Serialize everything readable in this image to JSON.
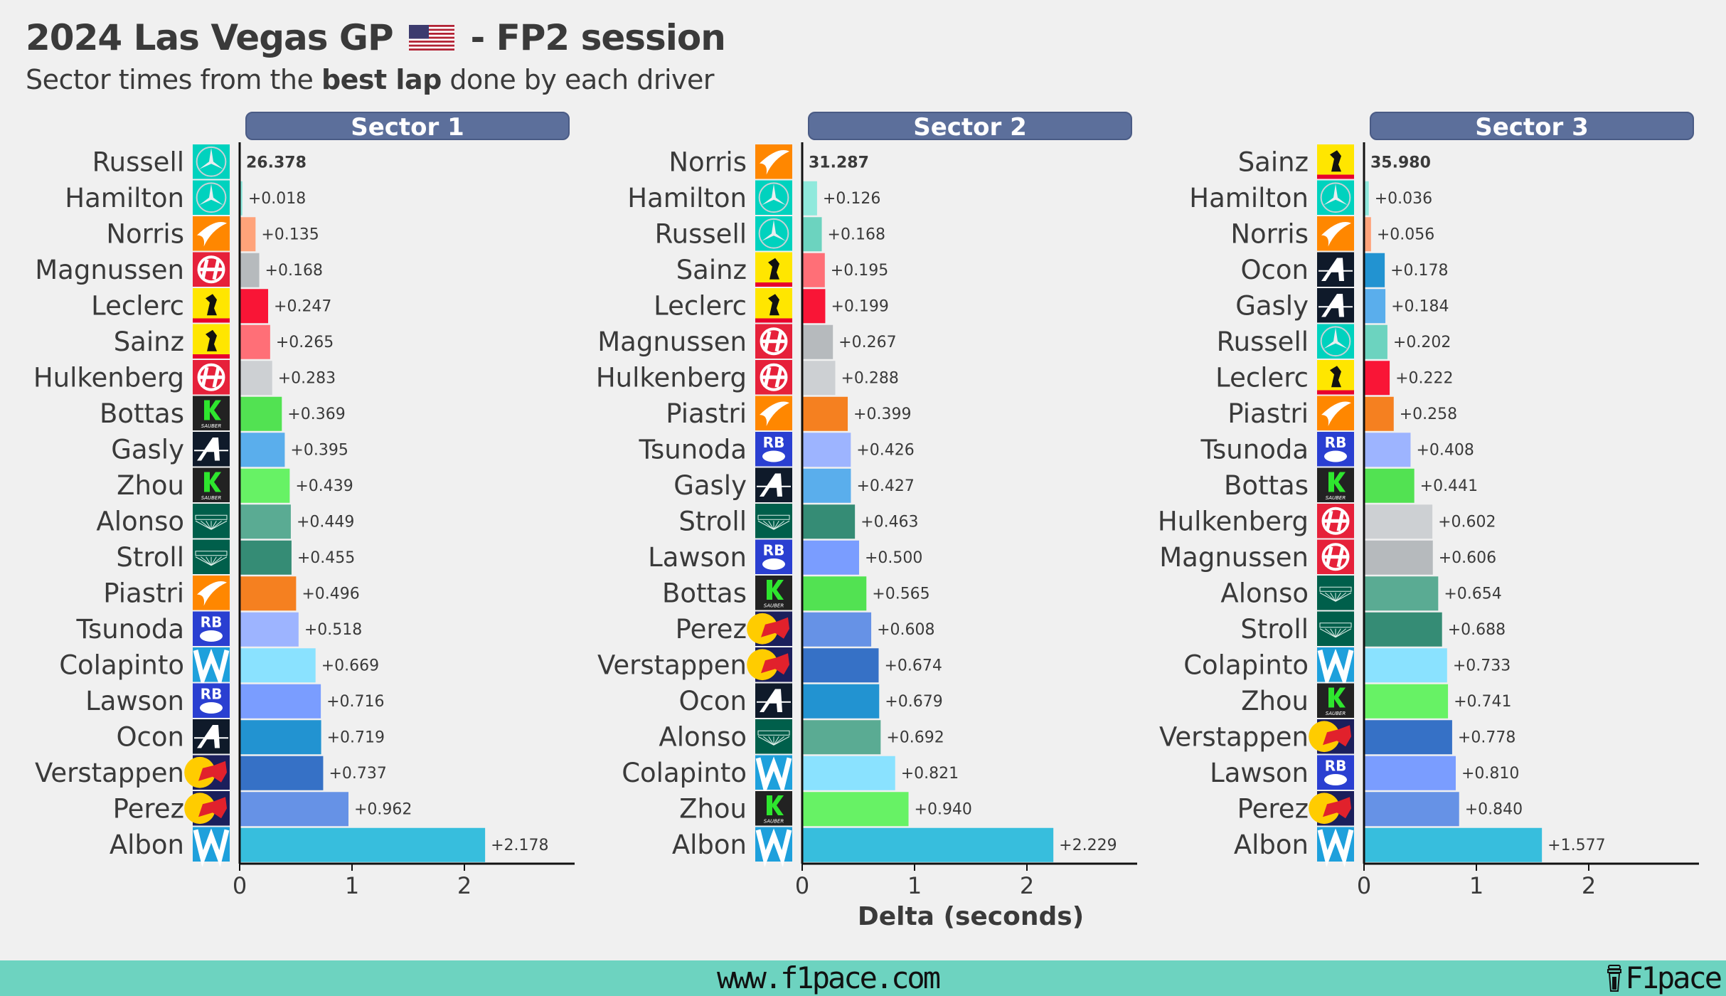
{
  "header": {
    "title_pre": "2024 Las Vegas GP",
    "title_post": "- FP2 session",
    "flag_icon": "us-flag-icon",
    "subtitle_pre": "Sector times from the ",
    "subtitle_bold": "best lap",
    "subtitle_post": " done by each driver"
  },
  "footer": {
    "url": "www.f1pace.com",
    "brand": "F1pace",
    "brand_icon": "coffee-cup-icon",
    "color": "#6dd3c0"
  },
  "teams": {
    "mercedes": {
      "icon": "mercedes-logo-icon",
      "bg": "#00d2be"
    },
    "mclaren": {
      "icon": "mclaren-logo-icon",
      "bg": "#ff8700"
    },
    "haas": {
      "icon": "haas-logo-icon",
      "bg": "#e6213a"
    },
    "ferrari": {
      "icon": "ferrari-logo-icon",
      "bg": "#ffe600"
    },
    "sauber": {
      "icon": "sauber-logo-icon",
      "bg": "#222222"
    },
    "alpine": {
      "icon": "alpine-logo-icon",
      "bg": "#0f1a2a"
    },
    "aston": {
      "icon": "aston-martin-logo-icon",
      "bg": "#005f4b"
    },
    "rb": {
      "icon": "rb-logo-icon",
      "bg": "#2a3fd1"
    },
    "williams": {
      "icon": "williams-logo-icon",
      "bg": "#1ea0dc"
    },
    "redbull": {
      "icon": "red-bull-logo-icon",
      "bg": "#1b1f5c"
    }
  },
  "chart_data": [
    {
      "type": "bar",
      "orientation": "horizontal",
      "title": "Sector 1",
      "xlabel": "",
      "xlim": [
        0,
        2.9
      ],
      "xticks": [
        0,
        1,
        2
      ],
      "best_time_label": "26.378",
      "drivers": [
        "Russell",
        "Hamilton",
        "Norris",
        "Magnussen",
        "Leclerc",
        "Sainz",
        "Hulkenberg",
        "Bottas",
        "Gasly",
        "Zhou",
        "Alonso",
        "Stroll",
        "Piastri",
        "Tsunoda",
        "Colapinto",
        "Lawson",
        "Ocon",
        "Verstappen",
        "Perez",
        "Albon"
      ],
      "teams": [
        "mercedes",
        "mercedes",
        "mclaren",
        "haas",
        "ferrari",
        "ferrari",
        "haas",
        "sauber",
        "alpine",
        "sauber",
        "aston",
        "aston",
        "mclaren",
        "rb",
        "williams",
        "rb",
        "alpine",
        "redbull",
        "redbull",
        "williams"
      ],
      "values": [
        0,
        0.018,
        0.135,
        0.168,
        0.247,
        0.265,
        0.283,
        0.369,
        0.395,
        0.439,
        0.449,
        0.455,
        0.496,
        0.518,
        0.669,
        0.716,
        0.719,
        0.737,
        0.962,
        2.178
      ],
      "labels": [
        "26.378",
        "+0.018",
        "+0.135",
        "+0.168",
        "+0.247",
        "+0.265",
        "+0.283",
        "+0.369",
        "+0.395",
        "+0.439",
        "+0.449",
        "+0.455",
        "+0.496",
        "+0.518",
        "+0.669",
        "+0.716",
        "+0.719",
        "+0.737",
        "+0.962",
        "+2.178"
      ],
      "colors": [
        "#6cd3bf",
        "#8fe9dc",
        "#ffa37a",
        "#b6babd",
        "#f91536",
        "#ff6f77",
        "#cdd0d3",
        "#52e252",
        "#5aaeec",
        "#67f265",
        "#5aab93",
        "#358c75",
        "#f58020",
        "#9db4ff",
        "#8ae2ff",
        "#7a9dff",
        "#2293d1",
        "#3671c6",
        "#6692e6",
        "#37bedd"
      ]
    },
    {
      "type": "bar",
      "orientation": "horizontal",
      "title": "Sector 2",
      "xlabel": "Delta (seconds)",
      "xlim": [
        0,
        2.9
      ],
      "xticks": [
        0,
        1,
        2
      ],
      "best_time_label": "31.287",
      "drivers": [
        "Norris",
        "Hamilton",
        "Russell",
        "Sainz",
        "Leclerc",
        "Magnussen",
        "Hulkenberg",
        "Piastri",
        "Tsunoda",
        "Gasly",
        "Stroll",
        "Lawson",
        "Bottas",
        "Perez",
        "Verstappen",
        "Ocon",
        "Alonso",
        "Colapinto",
        "Zhou",
        "Albon"
      ],
      "teams": [
        "mclaren",
        "mercedes",
        "mercedes",
        "ferrari",
        "ferrari",
        "haas",
        "haas",
        "mclaren",
        "rb",
        "alpine",
        "aston",
        "rb",
        "sauber",
        "redbull",
        "redbull",
        "alpine",
        "aston",
        "williams",
        "sauber",
        "williams"
      ],
      "values": [
        0,
        0.126,
        0.168,
        0.195,
        0.199,
        0.267,
        0.288,
        0.399,
        0.426,
        0.427,
        0.463,
        0.5,
        0.565,
        0.608,
        0.674,
        0.679,
        0.692,
        0.821,
        0.94,
        2.229
      ],
      "labels": [
        "31.287",
        "+0.126",
        "+0.168",
        "+0.195",
        "+0.199",
        "+0.267",
        "+0.288",
        "+0.399",
        "+0.426",
        "+0.427",
        "+0.463",
        "+0.500",
        "+0.565",
        "+0.608",
        "+0.674",
        "+0.679",
        "+0.692",
        "+0.821",
        "+0.940",
        "+2.229"
      ],
      "colors": [
        "#ffa37a",
        "#8fe9dc",
        "#6cd3bf",
        "#ff6f77",
        "#f91536",
        "#b6babd",
        "#cdd0d3",
        "#f58020",
        "#9db4ff",
        "#5aaeec",
        "#358c75",
        "#7a9dff",
        "#52e252",
        "#6692e6",
        "#3671c6",
        "#2293d1",
        "#5aab93",
        "#8ae2ff",
        "#67f265",
        "#37bedd"
      ]
    },
    {
      "type": "bar",
      "orientation": "horizontal",
      "title": "Sector 3",
      "xlabel": "",
      "xlim": [
        0,
        2.9
      ],
      "xticks": [
        0,
        1,
        2
      ],
      "best_time_label": "35.980",
      "drivers": [
        "Sainz",
        "Hamilton",
        "Norris",
        "Ocon",
        "Gasly",
        "Russell",
        "Leclerc",
        "Piastri",
        "Tsunoda",
        "Bottas",
        "Hulkenberg",
        "Magnussen",
        "Alonso",
        "Stroll",
        "Colapinto",
        "Zhou",
        "Verstappen",
        "Lawson",
        "Perez",
        "Albon"
      ],
      "teams": [
        "ferrari",
        "mercedes",
        "mclaren",
        "alpine",
        "alpine",
        "mercedes",
        "ferrari",
        "mclaren",
        "rb",
        "sauber",
        "haas",
        "haas",
        "aston",
        "aston",
        "williams",
        "sauber",
        "redbull",
        "rb",
        "redbull",
        "williams"
      ],
      "values": [
        0,
        0.036,
        0.056,
        0.178,
        0.184,
        0.202,
        0.222,
        0.258,
        0.408,
        0.441,
        0.602,
        0.606,
        0.654,
        0.688,
        0.733,
        0.741,
        0.778,
        0.81,
        0.84,
        1.577
      ],
      "labels": [
        "35.980",
        "+0.036",
        "+0.056",
        "+0.178",
        "+0.184",
        "+0.202",
        "+0.222",
        "+0.258",
        "+0.408",
        "+0.441",
        "+0.602",
        "+0.606",
        "+0.654",
        "+0.688",
        "+0.733",
        "+0.741",
        "+0.778",
        "+0.810",
        "+0.840",
        "+1.577"
      ],
      "colors": [
        "#ff6f77",
        "#8fe9dc",
        "#ffa37a",
        "#2293d1",
        "#5aaeec",
        "#6cd3bf",
        "#f91536",
        "#f58020",
        "#9db4ff",
        "#52e252",
        "#cdd0d3",
        "#b6babd",
        "#5aab93",
        "#358c75",
        "#8ae2ff",
        "#67f265",
        "#3671c6",
        "#7a9dff",
        "#6692e6",
        "#37bedd"
      ]
    }
  ]
}
